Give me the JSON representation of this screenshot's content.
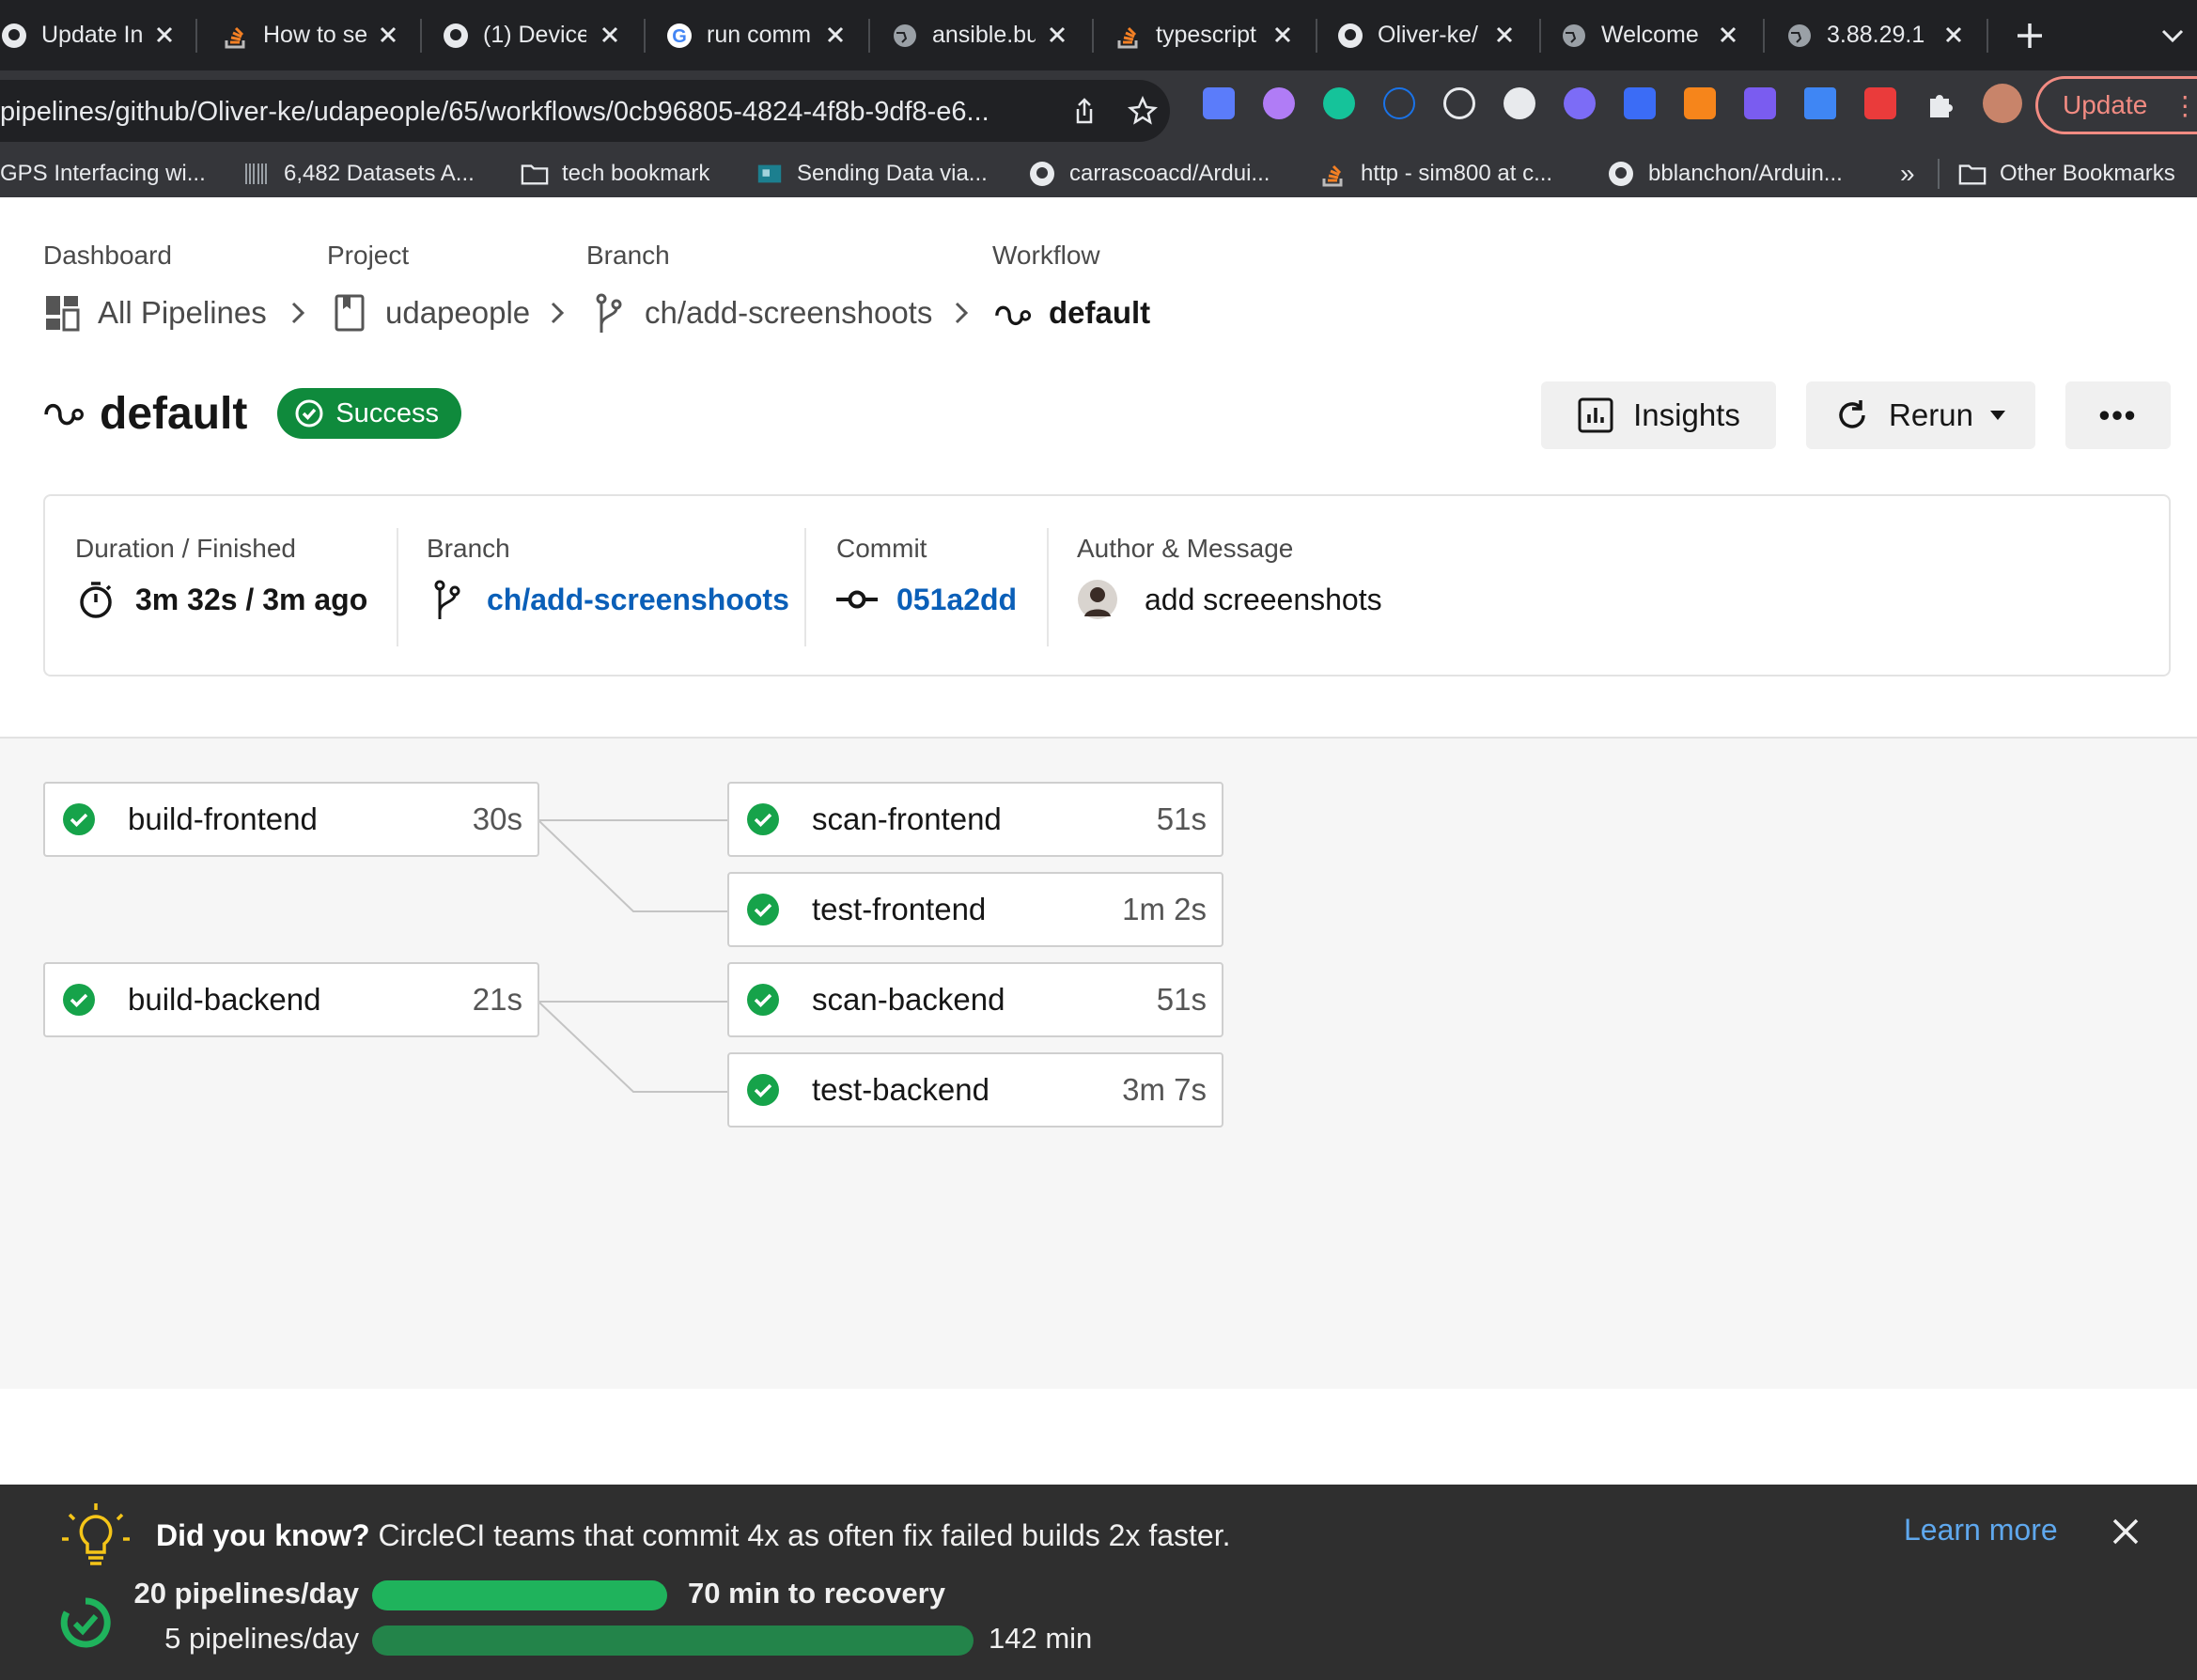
{
  "browser": {
    "tabs": [
      {
        "title": "Update In",
        "icon": "github-icon"
      },
      {
        "title": "How to se",
        "icon": "stackoverflow-icon"
      },
      {
        "title": "(1) Device",
        "icon": "github-icon"
      },
      {
        "title": "run comm",
        "icon": "google-icon"
      },
      {
        "title": "ansible.bu",
        "icon": "globe-icon"
      },
      {
        "title": "typescript",
        "icon": "stackoverflow-icon"
      },
      {
        "title": "Oliver-ke/",
        "icon": "github-icon"
      },
      {
        "title": "Welcome",
        "icon": "globe-icon"
      },
      {
        "title": "3.88.29.1",
        "icon": "globe-icon"
      }
    ],
    "url": "pipelines/github/Oliver-ke/udapeople/65/workflows/0cb96805-4824-4f8b-9df8-e6...",
    "update_label": "Update",
    "bookmarks": [
      {
        "title": "GPS Interfacing wi...",
        "icon": "none"
      },
      {
        "title": "6,482 Datasets A...",
        "icon": "barcode-icon"
      },
      {
        "title": "tech bookmark",
        "icon": "folder-icon"
      },
      {
        "title": "Sending Data via...",
        "icon": "board-icon"
      },
      {
        "title": "carrascoacd/Ardui...",
        "icon": "github-icon"
      },
      {
        "title": "http - sim800 at c...",
        "icon": "stackoverflow-icon"
      },
      {
        "title": "bblanchon/Arduin...",
        "icon": "github-icon"
      }
    ],
    "bookmarks_more": "»",
    "other_bookmarks": "Other Bookmarks"
  },
  "breadcrumbs": [
    {
      "label": "Dashboard",
      "value": "All Pipelines",
      "icon": "dashboard-icon"
    },
    {
      "label": "Project",
      "value": "udapeople",
      "icon": "book-icon"
    },
    {
      "label": "Branch",
      "value": "ch/add-screenshoots",
      "icon": "branch-icon"
    },
    {
      "label": "Workflow",
      "value": "default",
      "icon": "workflow-icon"
    }
  ],
  "workflow": {
    "title": "default",
    "status": "Success",
    "insights_label": "Insights",
    "rerun_label": "Rerun",
    "more_label": "•••"
  },
  "meta": {
    "duration_label": "Duration / Finished",
    "duration_value": "3m 32s / 3m ago",
    "branch_label": "Branch",
    "branch_value": "ch/add-screenshoots",
    "commit_label": "Commit",
    "commit_value": "051a2dd",
    "author_label": "Author & Message",
    "author_message": "add screeenshots"
  },
  "jobs": [
    {
      "name": "build-frontend",
      "duration": "30s",
      "status": "success"
    },
    {
      "name": "scan-frontend",
      "duration": "51s",
      "status": "success"
    },
    {
      "name": "test-frontend",
      "duration": "1m 2s",
      "status": "success"
    },
    {
      "name": "build-backend",
      "duration": "21s",
      "status": "success"
    },
    {
      "name": "scan-backend",
      "duration": "51s",
      "status": "success"
    },
    {
      "name": "test-backend",
      "duration": "3m 7s",
      "status": "success"
    }
  ],
  "banner": {
    "lead": "Did you know?",
    "text": " CircleCI teams that commit 4x as often fix failed builds 2x faster.",
    "learn_more": "Learn more",
    "stats": [
      {
        "label": "20 pipelines/day",
        "result": "70 min to recovery",
        "fraction": 0.49
      },
      {
        "label": "5 pipelines/day",
        "result": "142 min",
        "fraction": 1.0
      }
    ]
  },
  "colors": {
    "success": "#0f8a3c",
    "link": "#0a5fb8",
    "bar_green": "#1fb35c",
    "bar_dark": "#23844a"
  }
}
